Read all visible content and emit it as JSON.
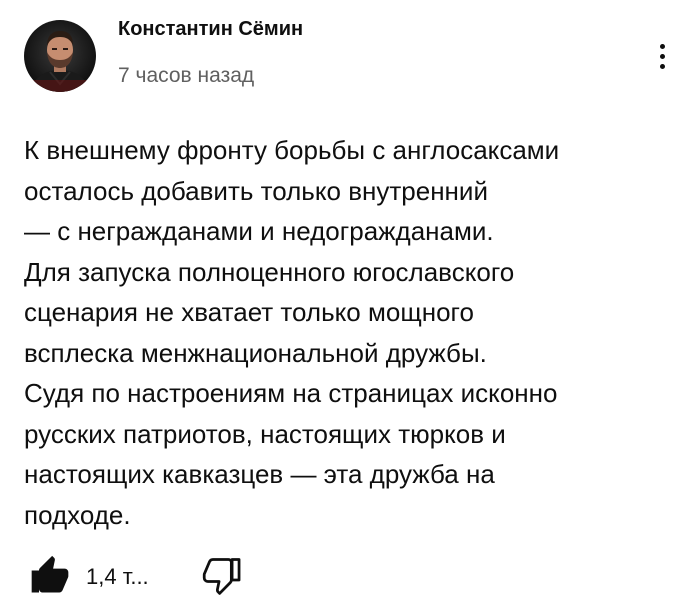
{
  "comment": {
    "author": {
      "name": "Константин Сёмин",
      "avatar_icon": "author-avatar-photo"
    },
    "timestamp": "7 часов назад",
    "menu_icon": "more-vert-icon",
    "body_lines": [
      "К внешнему фронту борьбы с англосаксами",
      "осталось добавить только внутренний",
      "— с негражданами и недогражданами.",
      "Для запуска полноценного югославского",
      "сценария не хватает только мощного",
      "всплеска менжнациональной дружбы.",
      "Судя по настроениям на страницах исконно",
      "русских патриотов, настоящих тюрков и",
      "настоящих кавказцев — эта дружба на",
      "подходе."
    ],
    "actions": {
      "like_icon": "thumbs-up-filled-icon",
      "like_count": "1,4 т...",
      "dislike_icon": "thumbs-down-outline-icon"
    }
  },
  "colors": {
    "text_primary": "#0f0f0f",
    "text_secondary": "#606060",
    "background": "#ffffff"
  }
}
